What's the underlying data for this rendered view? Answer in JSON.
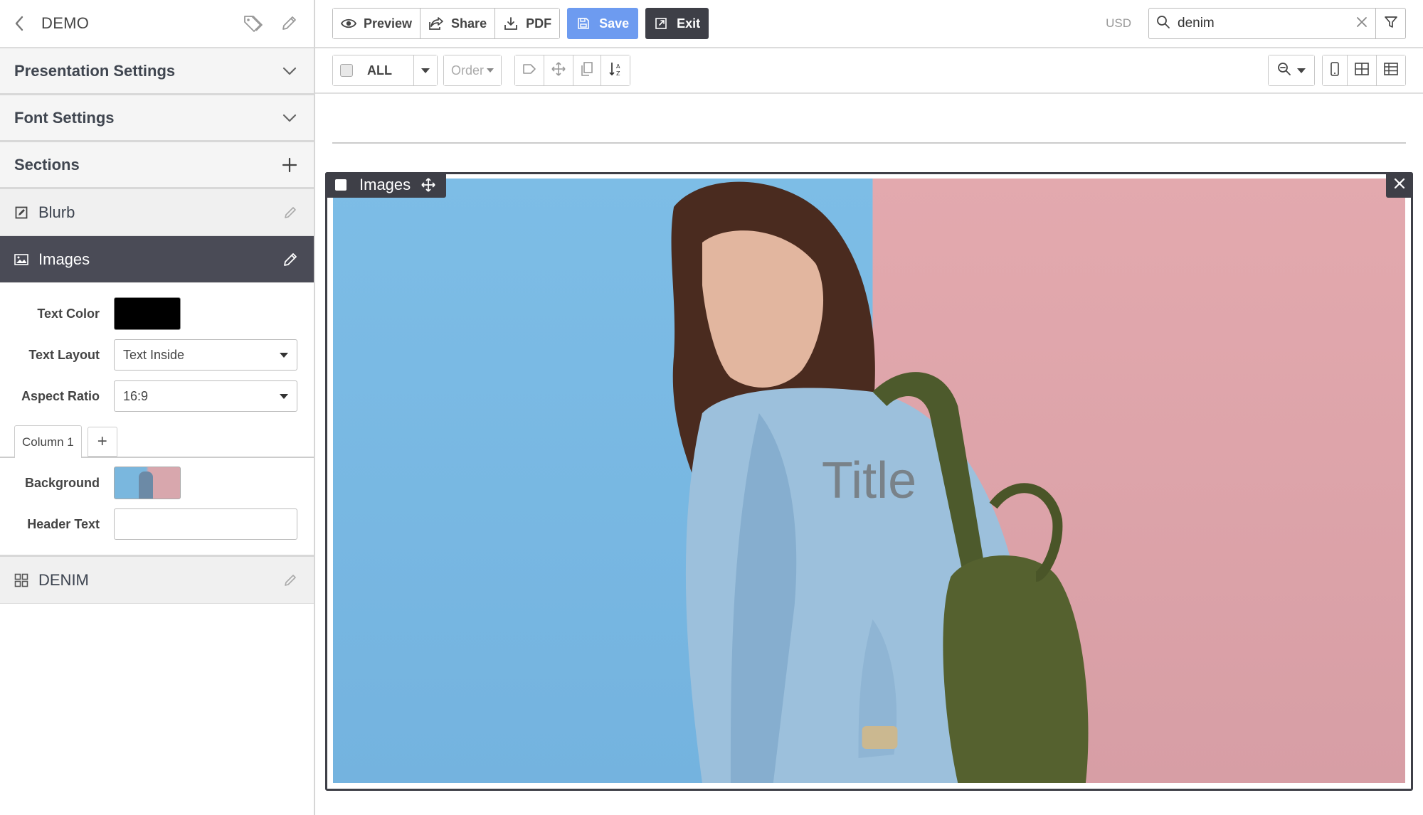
{
  "sidebar": {
    "title": "DEMO",
    "accordions": [
      {
        "label": "Presentation Settings",
        "icon": "chevron-down-icon"
      },
      {
        "label": "Font Settings",
        "icon": "chevron-down-icon"
      },
      {
        "label": "Sections",
        "icon": "plus-icon"
      }
    ],
    "sections": [
      {
        "label": "Blurb",
        "icon": "blurb-icon"
      },
      {
        "label": "Images",
        "icon": "image-icon",
        "active": true
      },
      {
        "label": "DENIM",
        "icon": "grid-icon"
      }
    ],
    "panel": {
      "text_color_label": "Text Color",
      "text_color_value": "#000000",
      "text_layout_label": "Text Layout",
      "text_layout_value": "Text Inside",
      "aspect_ratio_label": "Aspect Ratio",
      "aspect_ratio_value": "16:9",
      "tab_label": "Column 1",
      "tab_add": "+",
      "background_label": "Background",
      "header_text_label": "Header Text",
      "header_text_value": ""
    }
  },
  "topbar": {
    "preview": "Preview",
    "share": "Share",
    "pdf": "PDF",
    "save": "Save",
    "exit": "Exit",
    "currency": "USD",
    "search_value": "denim"
  },
  "toolbar": {
    "all": "ALL",
    "order": "Order"
  },
  "canvas": {
    "tag": "Images",
    "title_overlay": "Title"
  },
  "colors": {
    "accent": "#6d9bf0",
    "dark": "#3e3f47",
    "active_section": "#4a4b56"
  }
}
